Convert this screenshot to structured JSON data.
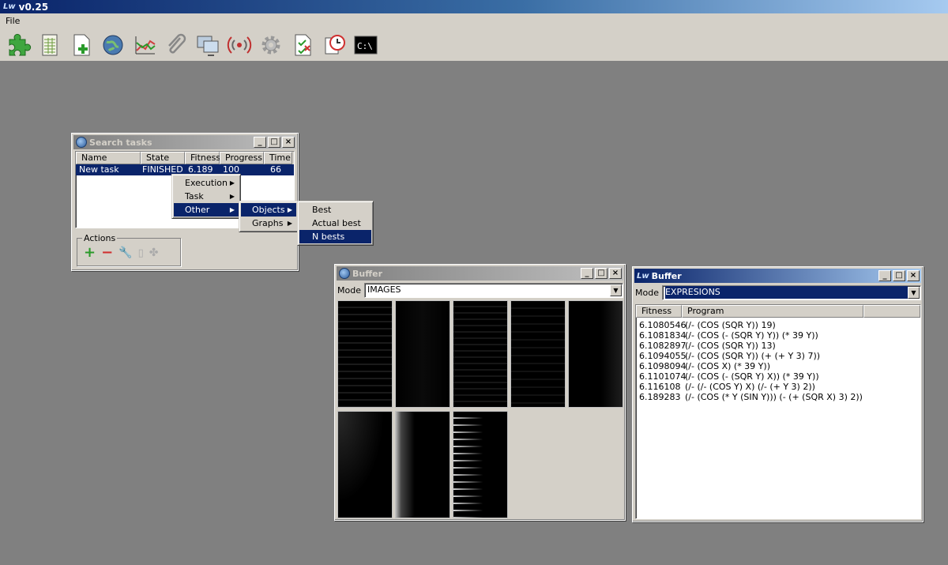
{
  "app": {
    "logo": "Lw",
    "title": "v0.25"
  },
  "menubar": {
    "file": "File"
  },
  "toolbar": [
    "puzzle-piece-icon",
    "spreadsheet-icon",
    "new-document-icon",
    "globe-icon",
    "line-chart-icon",
    "paperclip-icon",
    "monitors-icon",
    "signal-icon",
    "gear-icon",
    "document-check-icon",
    "alarm-clock-icon",
    "console-icon"
  ],
  "search_tasks": {
    "title": "Search tasks",
    "columns": [
      "Name",
      "State",
      "Fitness",
      "Progress",
      "Time"
    ],
    "rows": [
      {
        "name": "New task",
        "state": "FINISHED",
        "fitness": "6.189",
        "progress": "100",
        "time": "66"
      }
    ],
    "actions_label": "Actions"
  },
  "context_menu": {
    "items": [
      "Execution",
      "Task",
      "Other"
    ]
  },
  "submenu_other": {
    "items": [
      "Objects",
      "Graphs"
    ]
  },
  "submenu_objects": {
    "items": [
      "Best",
      "Actual best",
      "N bests"
    ]
  },
  "buffer_images": {
    "title": "Buffer",
    "mode_label": "Mode",
    "mode_value": "IMAGES"
  },
  "buffer_expr": {
    "title": "Buffer",
    "mode_label": "Mode",
    "mode_value": "EXPRESIONS",
    "columns": [
      "Fitness",
      "Program"
    ],
    "rows": [
      {
        "fitness": "6.1080546",
        "program": "(/- (COS (SQR Y)) 19)"
      },
      {
        "fitness": "6.1081834",
        "program": "(/- (COS (- (SQR Y) Y)) (* 39 Y))"
      },
      {
        "fitness": "6.1082897",
        "program": "(/- (COS (SQR Y)) 13)"
      },
      {
        "fitness": "6.1094055",
        "program": "(/- (COS (SQR Y)) (+ (+ Y 3) 7))"
      },
      {
        "fitness": "6.1098094",
        "program": "(/- (COS X) (* 39 Y))"
      },
      {
        "fitness": "6.1101074",
        "program": "(/- (COS (- (SQR Y) X)) (* 39 Y))"
      },
      {
        "fitness": "6.116108",
        "program": "(/- (/- (COS Y) X) (/- (+ Y 3) 2))"
      },
      {
        "fitness": "6.189283",
        "program": "(/- (COS (* Y (SIN Y))) (- (+ (SQR X) 3) 2))"
      }
    ]
  }
}
